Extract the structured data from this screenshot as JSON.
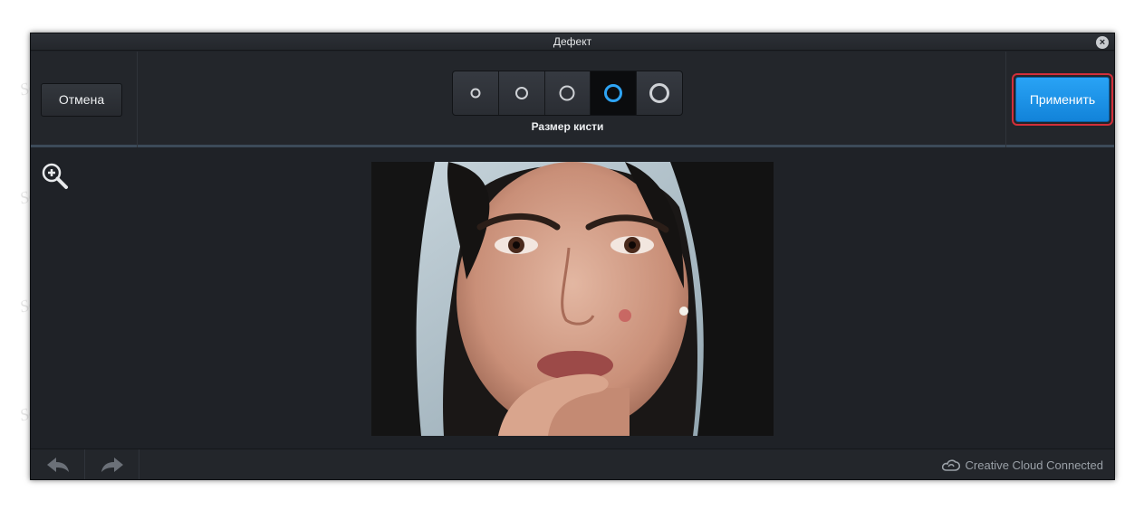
{
  "window": {
    "title": "Дефект",
    "close_glyph": "×"
  },
  "toolbar": {
    "cancel_label": "Отмена",
    "apply_label": "Применить",
    "brush_size_label": "Размер кисти",
    "brush_sizes": [
      {
        "name": "brush-size-1",
        "active": false
      },
      {
        "name": "brush-size-2",
        "active": false
      },
      {
        "name": "brush-size-3",
        "active": false
      },
      {
        "name": "brush-size-4",
        "active": true
      },
      {
        "name": "brush-size-5",
        "active": false
      }
    ]
  },
  "status": {
    "cc_text": "Creative Cloud Connected"
  },
  "watermark_text": "Soringpcrepair.Com",
  "colors": {
    "accent": "#1a90e6",
    "highlight_frame": "#d32f3a",
    "window_bg": "#1f2227"
  },
  "icons": {
    "zoom": "zoom-in-icon",
    "undo": "undo-arrow-icon",
    "redo": "redo-arrow-icon",
    "cc": "creative-cloud-icon"
  }
}
